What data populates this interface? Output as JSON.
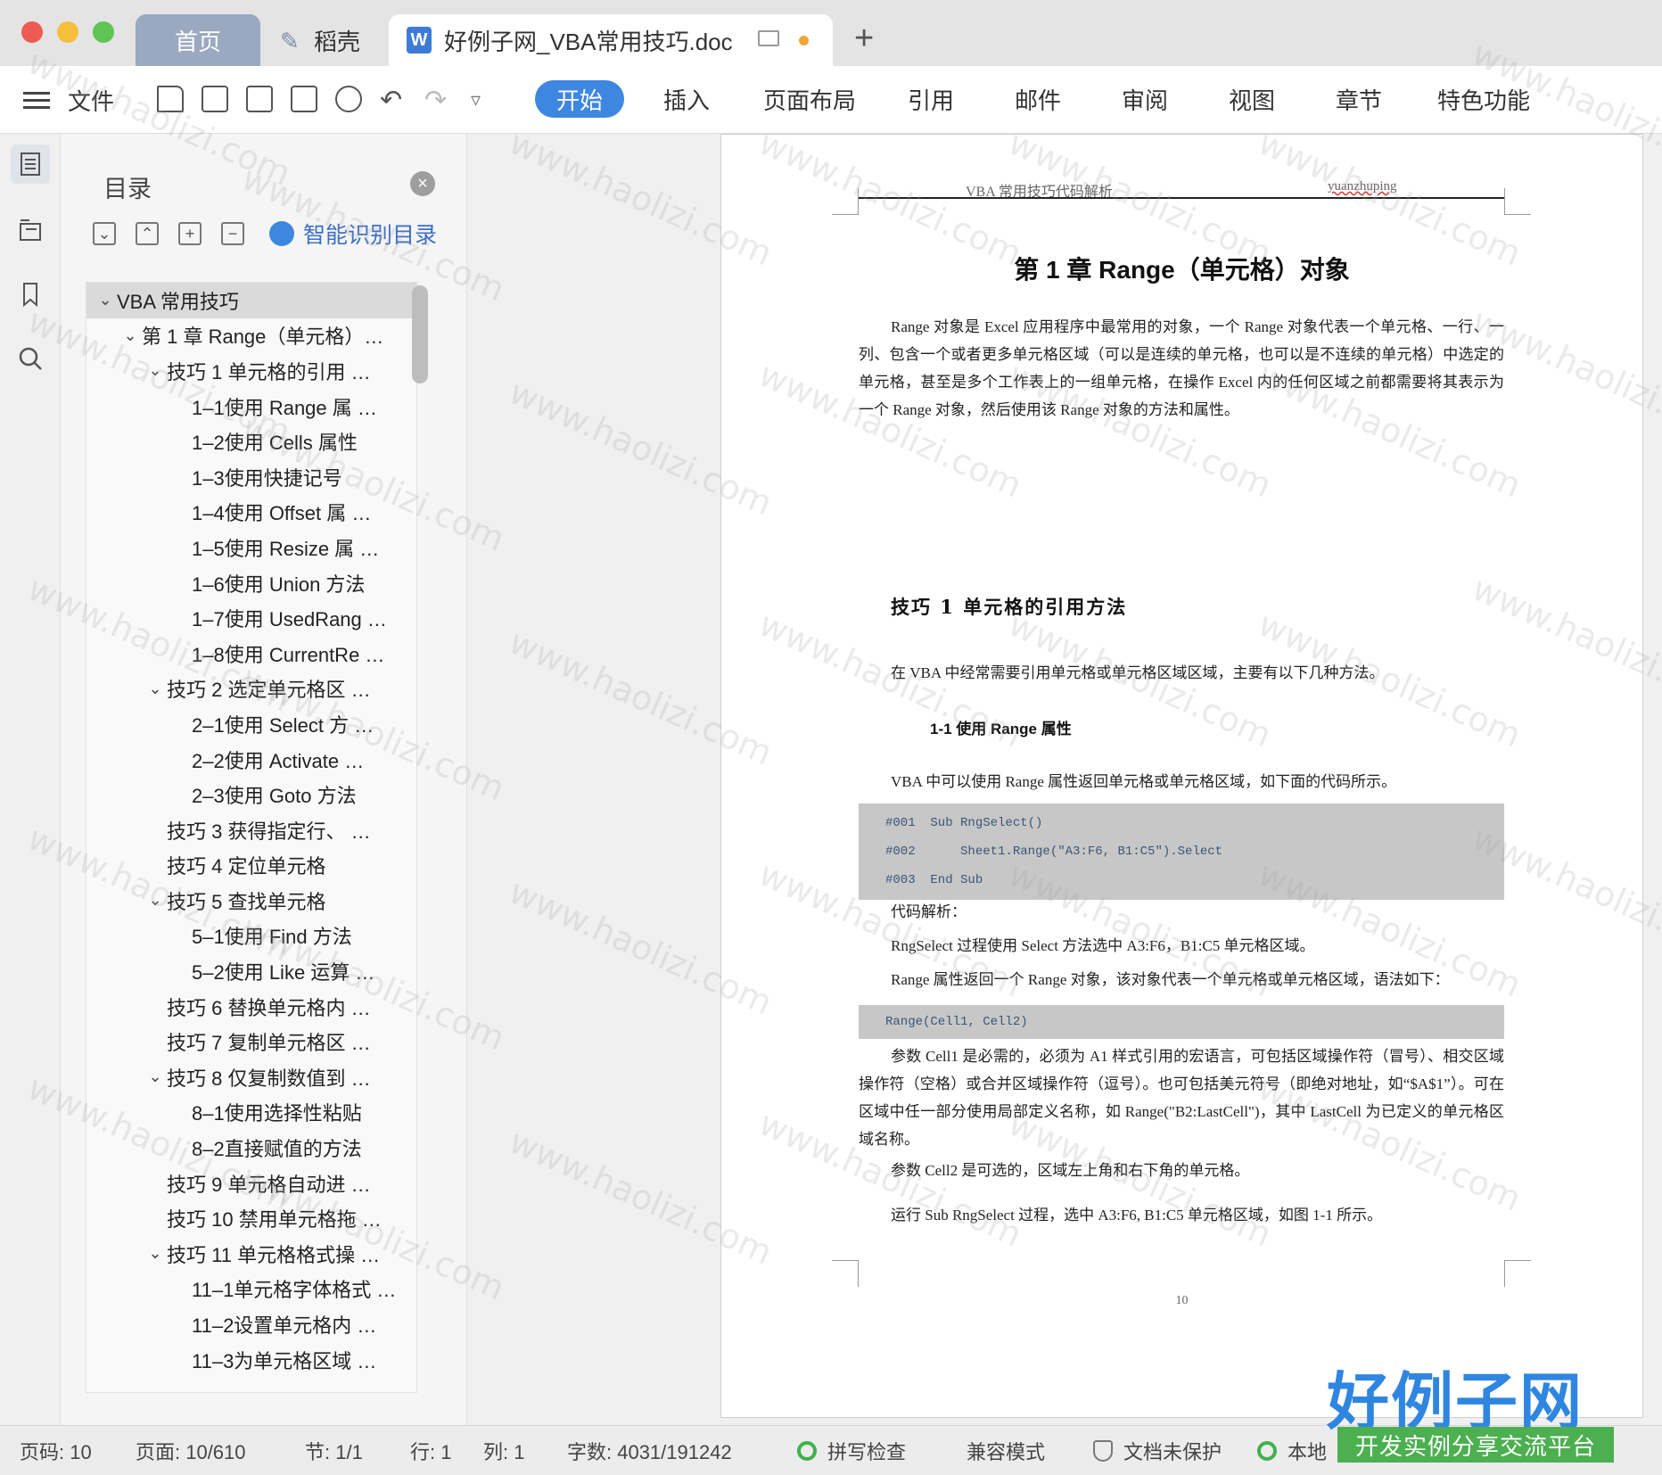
{
  "window": {
    "tabs": [
      {
        "label": "首页"
      },
      {
        "label": "稻壳"
      },
      {
        "label": "好例子网_VBA常用技巧.doc"
      }
    ]
  },
  "toolbar": {
    "file_label": "文件",
    "ribbon": [
      "开始",
      "插入",
      "页面布局",
      "引用",
      "邮件",
      "审阅",
      "视图",
      "章节",
      "特色功能"
    ]
  },
  "toc": {
    "title": "目录",
    "smart_label": "智能识别目录",
    "items": [
      {
        "label": "VBA 常用技巧",
        "level": 0,
        "expanded": true
      },
      {
        "label": "第 1 章  Range（单元格）…",
        "level": 1,
        "expanded": true
      },
      {
        "label": "技巧 1  单元格的引用 …",
        "level": 2,
        "expanded": true
      },
      {
        "label": "1–1使用 Range 属 …",
        "level": 3
      },
      {
        "label": "1–2使用 Cells 属性",
        "level": 3
      },
      {
        "label": "1–3使用快捷记号",
        "level": 3
      },
      {
        "label": "1–4使用 Offset 属 …",
        "level": 3
      },
      {
        "label": "1–5使用 Resize 属 …",
        "level": 3
      },
      {
        "label": "1–6使用 Union 方法",
        "level": 3
      },
      {
        "label": "1–7使用 UsedRang …",
        "level": 3
      },
      {
        "label": "1–8使用 CurrentRe …",
        "level": 3
      },
      {
        "label": "技巧 2  选定单元格区 …",
        "level": 2,
        "expanded": true
      },
      {
        "label": "2–1使用 Select 方 …",
        "level": 3
      },
      {
        "label": "2–2使用 Activate …",
        "level": 3
      },
      {
        "label": "2–3使用 Goto 方法",
        "level": 3
      },
      {
        "label": "技巧 3  获得指定行、 …",
        "level": 2
      },
      {
        "label": "技巧 4  定位单元格",
        "level": 2
      },
      {
        "label": "技巧 5  查找单元格",
        "level": 2,
        "expanded": true
      },
      {
        "label": "5–1使用 Find 方法",
        "level": 3
      },
      {
        "label": "5–2使用 Like 运算 …",
        "level": 3
      },
      {
        "label": "技巧 6  替换单元格内 …",
        "level": 2
      },
      {
        "label": "技巧 7  复制单元格区 …",
        "level": 2
      },
      {
        "label": "技巧 8  仅复制数值到 …",
        "level": 2,
        "expanded": true
      },
      {
        "label": "8–1使用选择性粘贴",
        "level": 3
      },
      {
        "label": "8–2直接赋值的方法",
        "level": 3
      },
      {
        "label": "技巧 9  单元格自动进 …",
        "level": 2
      },
      {
        "label": "技巧 10  禁用单元格拖 …",
        "level": 2
      },
      {
        "label": "技巧 11  单元格格式操 …",
        "level": 2,
        "expanded": true
      },
      {
        "label": "11–1单元格字体格式 …",
        "level": 3
      },
      {
        "label": "11–2设置单元格内 …",
        "level": 3
      },
      {
        "label": "11–3为单元格区域 …",
        "level": 3
      }
    ]
  },
  "document": {
    "header_left": "VBA 常用技巧代码解析",
    "header_right": "yuanzhuping",
    "chapter_title": "第 1 章   Range（单元格）对象",
    "intro": "Range 对象是 Excel 应用程序中最常用的对象，一个 Range 对象代表一个单元格、一行、一列、包含一个或者更多单元格区域（可以是连续的单元格，也可以是不连续的单元格）中选定的单元格，甚至是多个工作表上的一组单元格，在操作 Excel 内的任何区域之前都需要将其表示为一个 Range 对象，然后使用该 Range 对象的方法和属性。",
    "section_title": "技巧 1  单元格的引用方法",
    "section_intro": "在 VBA 中经常需要引用单元格或单元格区域区域，主要有以下几种方法。",
    "subsection_title": "1-1 使用 Range 属性",
    "sub_intro": "VBA 中可以使用 Range 属性返回单元格或单元格区域，如下面的代码所示。",
    "code": [
      "#001  Sub RngSelect()",
      "#002      Sheet1.Range(\"A3:F6, B1:C5\").Select",
      "#003  End Sub"
    ],
    "code_label": "代码解析：",
    "analysis1": "RngSelect 过程使用 Select 方法选中 A3:F6，B1:C5 单元格区域。",
    "analysis2": "Range 属性返回一个 Range 对象，该对象代表一个单元格或单元格区域，语法如下：",
    "syntax": "Range(Cell1, Cell2)",
    "param1": "参数 Cell1 是必需的，必须为 A1 样式引用的宏语言，可包括区域操作符（冒号）、相交区域操作符（空格）或合并区域操作符（逗号）。也可包括美元符号（即绝对地址，如“$A$1”）。可在区域中任一部分使用局部定义名称，如 Range(\"B2:LastCell\")，其中 LastCell 为已定义的单元格区域名称。",
    "param2": "参数 Cell2 是可选的，区域左上角和右下角的单元格。",
    "run": "运行 Sub RngSelect 过程，选中 A3:F6, B1:C5 单元格区域，如图 1-1 所示。",
    "page_number": "10"
  },
  "status": {
    "page_code": "页码: 10",
    "pages": "页面: 10/610",
    "section": "节: 1/1",
    "row": "行: 1",
    "col": "列: 1",
    "words": "字数: 4031/191242",
    "spell": "拼写检查",
    "compat": "兼容模式",
    "protect": "文档未保护",
    "local": "本地"
  },
  "watermark": {
    "text": "www.haolizi.com",
    "logo_main": "好例子网",
    "logo_sub": "开发实例分享交流平台"
  }
}
